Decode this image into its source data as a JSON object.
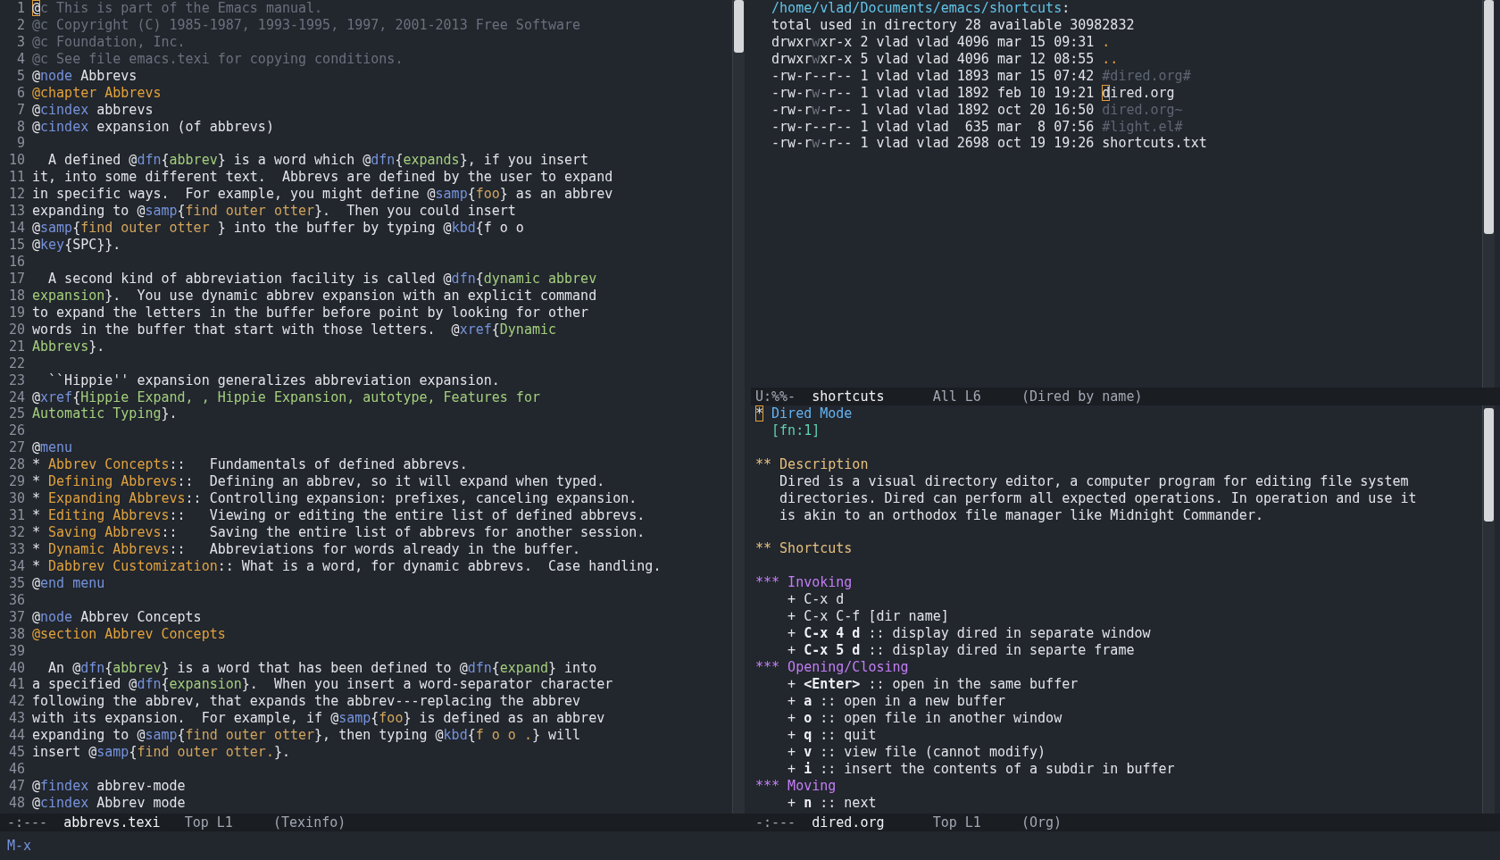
{
  "left_window": {
    "lines": [
      {
        "number": "1",
        "segments": [
          {
            "kind": "cursor",
            "text": "@"
          },
          {
            "kind": "comment",
            "text": "c This is part of the Emacs manual."
          }
        ]
      },
      {
        "number": "2",
        "segments": [
          {
            "kind": "comment",
            "text": "@c Copyright (C) 1985-1987, 1993-1995, 1997, 2001-2013 Free Software"
          }
        ]
      },
      {
        "number": "3",
        "segments": [
          {
            "kind": "comment",
            "text": "@c Foundation, Inc."
          }
        ]
      },
      {
        "number": "4",
        "segments": [
          {
            "kind": "comment",
            "text": "@c See file emacs.texi for copying conditions."
          }
        ]
      },
      {
        "number": "5",
        "segments": [
          {
            "kind": "plain",
            "text": "@"
          },
          {
            "kind": "keyword",
            "text": "node"
          },
          {
            "kind": "plain",
            "text": " Abbrevs"
          }
        ]
      },
      {
        "number": "6",
        "segments": [
          {
            "kind": "heading",
            "text": "@chapter Abbrevs"
          }
        ]
      },
      {
        "number": "7",
        "segments": [
          {
            "kind": "plain",
            "text": "@"
          },
          {
            "kind": "keyword",
            "text": "cindex"
          },
          {
            "kind": "plain",
            "text": " abbrevs"
          }
        ]
      },
      {
        "number": "8",
        "segments": [
          {
            "kind": "plain",
            "text": "@"
          },
          {
            "kind": "keyword",
            "text": "cindex"
          },
          {
            "kind": "plain",
            "text": " expansion (of abbrevs)"
          }
        ]
      },
      {
        "number": "9"
      },
      {
        "number": "10",
        "segments": [
          {
            "kind": "plain",
            "text": "  A defined @"
          },
          {
            "kind": "keyword",
            "text": "dfn"
          },
          {
            "kind": "plain",
            "text": "{"
          },
          {
            "kind": "arg",
            "text": "abbrev"
          },
          {
            "kind": "plain",
            "text": "} is a word which @"
          },
          {
            "kind": "keyword",
            "text": "dfn"
          },
          {
            "kind": "plain",
            "text": "{"
          },
          {
            "kind": "arg",
            "text": "expands"
          },
          {
            "kind": "plain",
            "text": "}, if you insert"
          }
        ]
      },
      {
        "number": "11",
        "segments": [
          {
            "kind": "plain",
            "text": "it, into some different text.  Abbrevs are defined by the user to expand"
          }
        ]
      },
      {
        "number": "12",
        "segments": [
          {
            "kind": "plain",
            "text": "in specific ways.  For example, you might define @"
          },
          {
            "kind": "keyword",
            "text": "samp"
          },
          {
            "kind": "plain",
            "text": "{"
          },
          {
            "kind": "samp",
            "text": "foo"
          },
          {
            "kind": "plain",
            "text": "} as an abbrev"
          }
        ]
      },
      {
        "number": "13",
        "segments": [
          {
            "kind": "plain",
            "text": "expanding to @"
          },
          {
            "kind": "keyword",
            "text": "samp"
          },
          {
            "kind": "plain",
            "text": "{"
          },
          {
            "kind": "samp",
            "text": "find outer otter"
          },
          {
            "kind": "plain",
            "text": "}.  Then you could insert"
          }
        ]
      },
      {
        "number": "14",
        "segments": [
          {
            "kind": "plain",
            "text": "@"
          },
          {
            "kind": "keyword",
            "text": "samp"
          },
          {
            "kind": "plain",
            "text": "{"
          },
          {
            "kind": "samp",
            "text": "find outer otter "
          },
          {
            "kind": "plain",
            "text": "} into the buffer by typing @"
          },
          {
            "kind": "keyword",
            "text": "kbd"
          },
          {
            "kind": "plain",
            "text": "{f o o"
          }
        ]
      },
      {
        "number": "15",
        "segments": [
          {
            "kind": "plain",
            "text": "@"
          },
          {
            "kind": "keyword",
            "text": "key"
          },
          {
            "kind": "plain",
            "text": "{SPC}}."
          }
        ]
      },
      {
        "number": "16"
      },
      {
        "number": "17",
        "segments": [
          {
            "kind": "plain",
            "text": "  A second kind of abbreviation facility is called @"
          },
          {
            "kind": "keyword",
            "text": "dfn"
          },
          {
            "kind": "plain",
            "text": "{"
          },
          {
            "kind": "arg",
            "text": "dynamic abbrev"
          }
        ]
      },
      {
        "number": "18",
        "segments": [
          {
            "kind": "arg",
            "text": "expansion"
          },
          {
            "kind": "plain",
            "text": "}.  You use dynamic abbrev expansion with an explicit command"
          }
        ]
      },
      {
        "number": "19",
        "segments": [
          {
            "kind": "plain",
            "text": "to expand the letters in the buffer before point by looking for other"
          }
        ]
      },
      {
        "number": "20",
        "segments": [
          {
            "kind": "plain",
            "text": "words in the buffer that start with those letters.  @"
          },
          {
            "kind": "keyword",
            "text": "xref"
          },
          {
            "kind": "plain",
            "text": "{"
          },
          {
            "kind": "arg",
            "text": "Dynamic"
          }
        ]
      },
      {
        "number": "21",
        "segments": [
          {
            "kind": "arg",
            "text": "Abbrevs"
          },
          {
            "kind": "plain",
            "text": "}."
          }
        ]
      },
      {
        "number": "22"
      },
      {
        "number": "23",
        "segments": [
          {
            "kind": "plain",
            "text": "  ``Hippie'' expansion generalizes abbreviation expansion."
          }
        ]
      },
      {
        "number": "24",
        "segments": [
          {
            "kind": "plain",
            "text": "@"
          },
          {
            "kind": "keyword",
            "text": "xref"
          },
          {
            "kind": "plain",
            "text": "{"
          },
          {
            "kind": "arg",
            "text": "Hippie Expand, , Hippie Expansion, autotype, Features for"
          }
        ]
      },
      {
        "number": "25",
        "segments": [
          {
            "kind": "arg",
            "text": "Automatic Typing"
          },
          {
            "kind": "plain",
            "text": "}."
          }
        ]
      },
      {
        "number": "26"
      },
      {
        "number": "27",
        "segments": [
          {
            "kind": "plain",
            "text": "@"
          },
          {
            "kind": "keyword",
            "text": "menu"
          }
        ]
      },
      {
        "number": "28",
        "segments": [
          {
            "kind": "plain",
            "text": "* "
          },
          {
            "kind": "menu",
            "text": "Abbrev Concepts"
          },
          {
            "kind": "plain",
            "text": "::   Fundamentals of defined abbrevs."
          }
        ]
      },
      {
        "number": "29",
        "segments": [
          {
            "kind": "plain",
            "text": "* "
          },
          {
            "kind": "menu",
            "text": "Defining Abbrevs"
          },
          {
            "kind": "plain",
            "text": "::  Defining an abbrev, so it will expand when typed."
          }
        ]
      },
      {
        "number": "30",
        "segments": [
          {
            "kind": "plain",
            "text": "* "
          },
          {
            "kind": "menu",
            "text": "Expanding Abbrevs"
          },
          {
            "kind": "plain",
            "text": ":: Controlling expansion: prefixes, canceling expansion."
          }
        ]
      },
      {
        "number": "31",
        "segments": [
          {
            "kind": "plain",
            "text": "* "
          },
          {
            "kind": "menu",
            "text": "Editing Abbrevs"
          },
          {
            "kind": "plain",
            "text": "::   Viewing or editing the entire list of defined abbrevs."
          }
        ]
      },
      {
        "number": "32",
        "segments": [
          {
            "kind": "plain",
            "text": "* "
          },
          {
            "kind": "menu",
            "text": "Saving Abbrevs"
          },
          {
            "kind": "plain",
            "text": "::    Saving the entire list of abbrevs for another session."
          }
        ]
      },
      {
        "number": "33",
        "segments": [
          {
            "kind": "plain",
            "text": "* "
          },
          {
            "kind": "menu",
            "text": "Dynamic Abbrevs"
          },
          {
            "kind": "plain",
            "text": "::   Abbreviations for words already in the buffer."
          }
        ]
      },
      {
        "number": "34",
        "segments": [
          {
            "kind": "plain",
            "text": "* "
          },
          {
            "kind": "menu",
            "text": "Dabbrev Customization"
          },
          {
            "kind": "plain",
            "text": ":: What is a word, for dynamic abbrevs.  Case handling."
          }
        ]
      },
      {
        "number": "35",
        "segments": [
          {
            "kind": "plain",
            "text": "@"
          },
          {
            "kind": "keyword",
            "text": "end menu"
          }
        ]
      },
      {
        "number": "36"
      },
      {
        "number": "37",
        "segments": [
          {
            "kind": "plain",
            "text": "@"
          },
          {
            "kind": "keyword",
            "text": "node"
          },
          {
            "kind": "plain",
            "text": " Abbrev Concepts"
          }
        ]
      },
      {
        "number": "38",
        "segments": [
          {
            "kind": "heading",
            "text": "@section Abbrev Concepts"
          }
        ]
      },
      {
        "number": "39"
      },
      {
        "number": "40",
        "segments": [
          {
            "kind": "plain",
            "text": "  An @"
          },
          {
            "kind": "keyword",
            "text": "dfn"
          },
          {
            "kind": "plain",
            "text": "{"
          },
          {
            "kind": "arg",
            "text": "abbrev"
          },
          {
            "kind": "plain",
            "text": "} is a word that has been defined to @"
          },
          {
            "kind": "keyword",
            "text": "dfn"
          },
          {
            "kind": "plain",
            "text": "{"
          },
          {
            "kind": "arg",
            "text": "expand"
          },
          {
            "kind": "plain",
            "text": "} into"
          }
        ]
      },
      {
        "number": "41",
        "segments": [
          {
            "kind": "plain",
            "text": "a specified @"
          },
          {
            "kind": "keyword",
            "text": "dfn"
          },
          {
            "kind": "plain",
            "text": "{"
          },
          {
            "kind": "arg",
            "text": "expansion"
          },
          {
            "kind": "plain",
            "text": "}.  When you insert a word-separator character"
          }
        ]
      },
      {
        "number": "42",
        "segments": [
          {
            "kind": "plain",
            "text": "following the abbrev, that expands the abbrev---replacing the abbrev"
          }
        ]
      },
      {
        "number": "43",
        "segments": [
          {
            "kind": "plain",
            "text": "with its expansion.  For example, if @"
          },
          {
            "kind": "keyword",
            "text": "samp"
          },
          {
            "kind": "plain",
            "text": "{"
          },
          {
            "kind": "samp",
            "text": "foo"
          },
          {
            "kind": "plain",
            "text": "} is defined as an abbrev"
          }
        ]
      },
      {
        "number": "44",
        "segments": [
          {
            "kind": "plain",
            "text": "expanding to @"
          },
          {
            "kind": "keyword",
            "text": "samp"
          },
          {
            "kind": "plain",
            "text": "{"
          },
          {
            "kind": "samp",
            "text": "find outer otter"
          },
          {
            "kind": "plain",
            "text": "}, then typing @"
          },
          {
            "kind": "keyword",
            "text": "kbd"
          },
          {
            "kind": "plain",
            "text": "{"
          },
          {
            "kind": "samp",
            "text": "f o o ."
          },
          {
            "kind": "plain",
            "text": "} will"
          }
        ]
      },
      {
        "number": "45",
        "segments": [
          {
            "kind": "plain",
            "text": "insert @"
          },
          {
            "kind": "keyword",
            "text": "samp"
          },
          {
            "kind": "plain",
            "text": "{"
          },
          {
            "kind": "samp",
            "text": "find outer otter."
          },
          {
            "kind": "plain",
            "text": "}."
          }
        ]
      },
      {
        "number": "46"
      },
      {
        "number": "47",
        "segments": [
          {
            "kind": "plain",
            "text": "@"
          },
          {
            "kind": "keyword",
            "text": "findex"
          },
          {
            "kind": "plain",
            "text": " abbrev-mode"
          }
        ]
      },
      {
        "number": "48",
        "segments": [
          {
            "kind": "plain",
            "text": "@"
          },
          {
            "kind": "keyword",
            "text": "cindex"
          },
          {
            "kind": "plain",
            "text": " Abbrev mode"
          }
        ]
      }
    ],
    "mode_line": {
      "status": "-:---",
      "buffer": "abbrevs.texi",
      "position": "Top L1",
      "mode": "(Texinfo)"
    }
  },
  "top_right_window": {
    "lines": [
      {
        "segments": [
          {
            "kind": "path",
            "text": "  /home/vlad/Documents/emacs/shortcuts"
          },
          {
            "kind": "plain",
            "text": ":"
          }
        ]
      },
      {
        "segments": [
          {
            "kind": "plain",
            "text": "  total used in directory 28 available 30982832"
          }
        ]
      },
      {
        "segments": [
          {
            "kind": "plain",
            "text": "  drwxr"
          },
          {
            "kind": "dim",
            "text": "w"
          },
          {
            "kind": "plain",
            "text": "xr-x 2 vlad vlad 4096 mar 15 09:31 "
          },
          {
            "kind": "dotfile",
            "text": "."
          }
        ]
      },
      {
        "segments": [
          {
            "kind": "plain",
            "text": "  drwxr"
          },
          {
            "kind": "dim",
            "text": "w"
          },
          {
            "kind": "plain",
            "text": "xr-x 5 vlad vlad 4096 mar 12 08:55 "
          },
          {
            "kind": "dotfile",
            "text": ".."
          }
        ]
      },
      {
        "segments": [
          {
            "kind": "plain",
            "text": "  -rw-r--r-- 1 vlad vlad 1893 mar 15 07:42 "
          },
          {
            "kind": "backup",
            "text": "#dired.org#"
          }
        ]
      },
      {
        "segments": [
          {
            "kind": "plain",
            "text": "  -rw-r"
          },
          {
            "kind": "dim",
            "text": "w"
          },
          {
            "kind": "plain",
            "text": "-r-- 1 vlad vlad 1892 feb 10 19:21 "
          },
          {
            "kind": "cursor",
            "text": "d"
          },
          {
            "kind": "plain",
            "text": "ired.org"
          }
        ]
      },
      {
        "segments": [
          {
            "kind": "plain",
            "text": "  -rw-r"
          },
          {
            "kind": "dim",
            "text": "w"
          },
          {
            "kind": "plain",
            "text": "-r-- 1 vlad vlad 1892 oct 20 16:50 "
          },
          {
            "kind": "backup",
            "text": "dired.org~"
          }
        ]
      },
      {
        "segments": [
          {
            "kind": "plain",
            "text": "  -rw-r--r-- 1 vlad vlad  635 mar  8 07:56 "
          },
          {
            "kind": "backup",
            "text": "#light.el#"
          }
        ]
      },
      {
        "segments": [
          {
            "kind": "plain",
            "text": "  -rw-r"
          },
          {
            "kind": "dim",
            "text": "w"
          },
          {
            "kind": "plain",
            "text": "-r-- 1 vlad vlad 2698 oct 19 19:26 shortcuts.txt"
          }
        ]
      }
    ],
    "mode_line": {
      "status": "U:%%-",
      "buffer": "shortcuts",
      "position": "All L6",
      "mode": "(Dired by name)"
    }
  },
  "bottom_right_window": {
    "lines": [
      {
        "segments": [
          {
            "kind": "cursor",
            "text": "*"
          },
          {
            "kind": "org1",
            "text": " Dired Mode"
          }
        ]
      },
      {
        "segments": [
          {
            "kind": "footnote",
            "text": "  [fn:1]"
          }
        ]
      },
      {
        "space_before": true,
        "segments": [
          {
            "kind": "org2",
            "text": "** Description"
          }
        ]
      },
      {
        "segments": [
          {
            "kind": "plain",
            "text": "   Dired is a visual directory editor, a computer program for editing file system"
          }
        ]
      },
      {
        "segments": [
          {
            "kind": "plain",
            "text": "   directories. Dired can perform all expected operations. In operation and use it"
          }
        ]
      },
      {
        "segments": [
          {
            "kind": "plain",
            "text": "   is akin to an orthodox file manager like Midnight Commander."
          }
        ]
      },
      {
        "space_before": true,
        "segments": [
          {
            "kind": "org2",
            "text": "** Shortcuts"
          }
        ]
      },
      {
        "space_before": true,
        "segments": [
          {
            "kind": "org3",
            "text": "*** Invoking"
          }
        ]
      },
      {
        "segments": [
          {
            "kind": "plain",
            "text": "    + C-x d"
          }
        ]
      },
      {
        "segments": [
          {
            "kind": "plain",
            "text": "    + C-x C-f [dir name]"
          }
        ]
      },
      {
        "segments": [
          {
            "kind": "plain",
            "text": "    + "
          },
          {
            "kind": "bold",
            "text": "C-x 4 d"
          },
          {
            "kind": "plain",
            "text": " :: display dired in separate window"
          }
        ]
      },
      {
        "segments": [
          {
            "kind": "plain",
            "text": "    + "
          },
          {
            "kind": "bold",
            "text": "C-x 5 d"
          },
          {
            "kind": "plain",
            "text": " :: display dired in separte frame"
          }
        ]
      },
      {
        "segments": [
          {
            "kind": "org3",
            "text": "*** Opening/Closing"
          }
        ]
      },
      {
        "segments": [
          {
            "kind": "plain",
            "text": "    + "
          },
          {
            "kind": "bold",
            "text": "<Enter>"
          },
          {
            "kind": "plain",
            "text": " :: open in the same buffer"
          }
        ]
      },
      {
        "segments": [
          {
            "kind": "plain",
            "text": "    + "
          },
          {
            "kind": "bold",
            "text": "a"
          },
          {
            "kind": "plain",
            "text": " :: open in a new buffer"
          }
        ]
      },
      {
        "segments": [
          {
            "kind": "plain",
            "text": "    + "
          },
          {
            "kind": "bold",
            "text": "o"
          },
          {
            "kind": "plain",
            "text": " :: open file in another window"
          }
        ]
      },
      {
        "segments": [
          {
            "kind": "plain",
            "text": "    + "
          },
          {
            "kind": "bold",
            "text": "q"
          },
          {
            "kind": "plain",
            "text": " :: quit"
          }
        ]
      },
      {
        "segments": [
          {
            "kind": "plain",
            "text": "    + "
          },
          {
            "kind": "bold",
            "text": "v"
          },
          {
            "kind": "plain",
            "text": " :: view file (cannot modify)"
          }
        ]
      },
      {
        "segments": [
          {
            "kind": "plain",
            "text": "    + "
          },
          {
            "kind": "bold",
            "text": "i"
          },
          {
            "kind": "plain",
            "text": " :: insert the contents of a subdir in buffer"
          }
        ]
      },
      {
        "segments": [
          {
            "kind": "org3",
            "text": "*** Moving"
          }
        ]
      },
      {
        "segments": [
          {
            "kind": "plain",
            "text": "    + "
          },
          {
            "kind": "bold",
            "text": "n"
          },
          {
            "kind": "plain",
            "text": " :: next"
          }
        ]
      }
    ],
    "mode_line": {
      "status": "-:---",
      "buffer": "dired.org",
      "position": "Top L1",
      "mode": "(Org)"
    }
  },
  "minibuffer": {
    "prompt": "M-x"
  }
}
